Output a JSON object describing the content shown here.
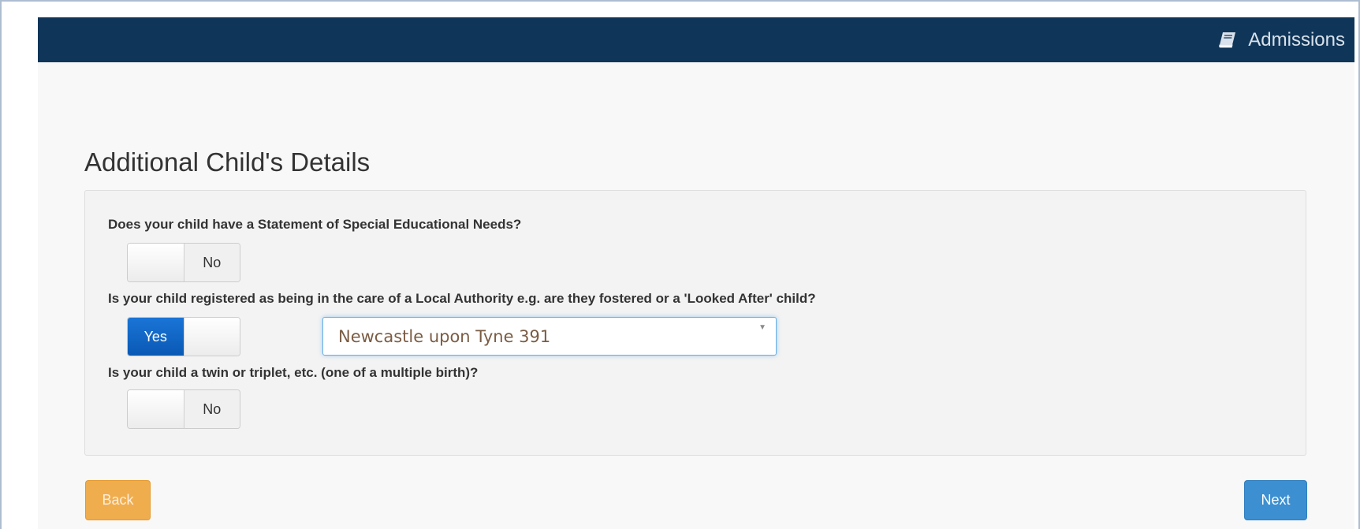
{
  "header": {
    "app_name": "Admissions",
    "icon": "book-icon"
  },
  "page": {
    "title": "Additional Child's Details"
  },
  "questions": [
    {
      "label": "Does your child have a Statement of Special Educational Needs?",
      "toggle": {
        "state": "off",
        "label": "No"
      }
    },
    {
      "label": "Is your child registered as being in the care of a Local Authority e.g. are they fostered or a 'Looked After' child?",
      "toggle": {
        "state": "on",
        "label": "Yes"
      },
      "authority_select": {
        "value": "Newcastle upon Tyne 391"
      }
    },
    {
      "label": "Is your child a twin or triplet, etc. (one of a multiple birth)?",
      "toggle": {
        "state": "off",
        "label": "No"
      }
    }
  ],
  "actions": {
    "back_label": "Back",
    "next_label": "Next"
  },
  "colors": {
    "navbar": "#0f3659",
    "toggle_on": "#0a58b5",
    "back_button": "#f0ad4e",
    "next_button": "#3c8fd0"
  }
}
